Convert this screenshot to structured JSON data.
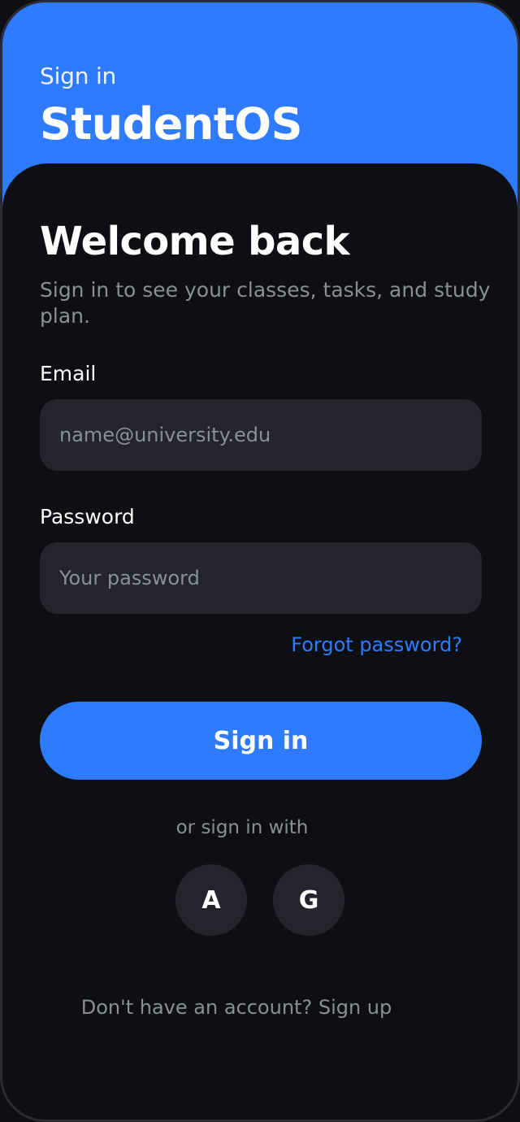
{
  "header": {
    "subtitle": "Sign in",
    "title": "StudentOS"
  },
  "welcome": {
    "title": "Welcome back",
    "subtitle": "Sign in to see your classes, tasks, and study plan."
  },
  "form": {
    "email_label": "Email",
    "email_placeholder": "name@university.edu",
    "email_value": "",
    "password_label": "Password",
    "password_placeholder": "Your password",
    "password_value": "",
    "forgot_label": "Forgot password?",
    "submit_label": "Sign in"
  },
  "social": {
    "divider": "or sign in with",
    "providers": [
      "A",
      "G"
    ]
  },
  "footer": {
    "prompt": "Don't have an account?",
    "link": "Sign up"
  },
  "colors": {
    "accent": "#2f7bff",
    "background": "#0e0f13",
    "field": "#23242c",
    "muted": "#8b8e98"
  }
}
